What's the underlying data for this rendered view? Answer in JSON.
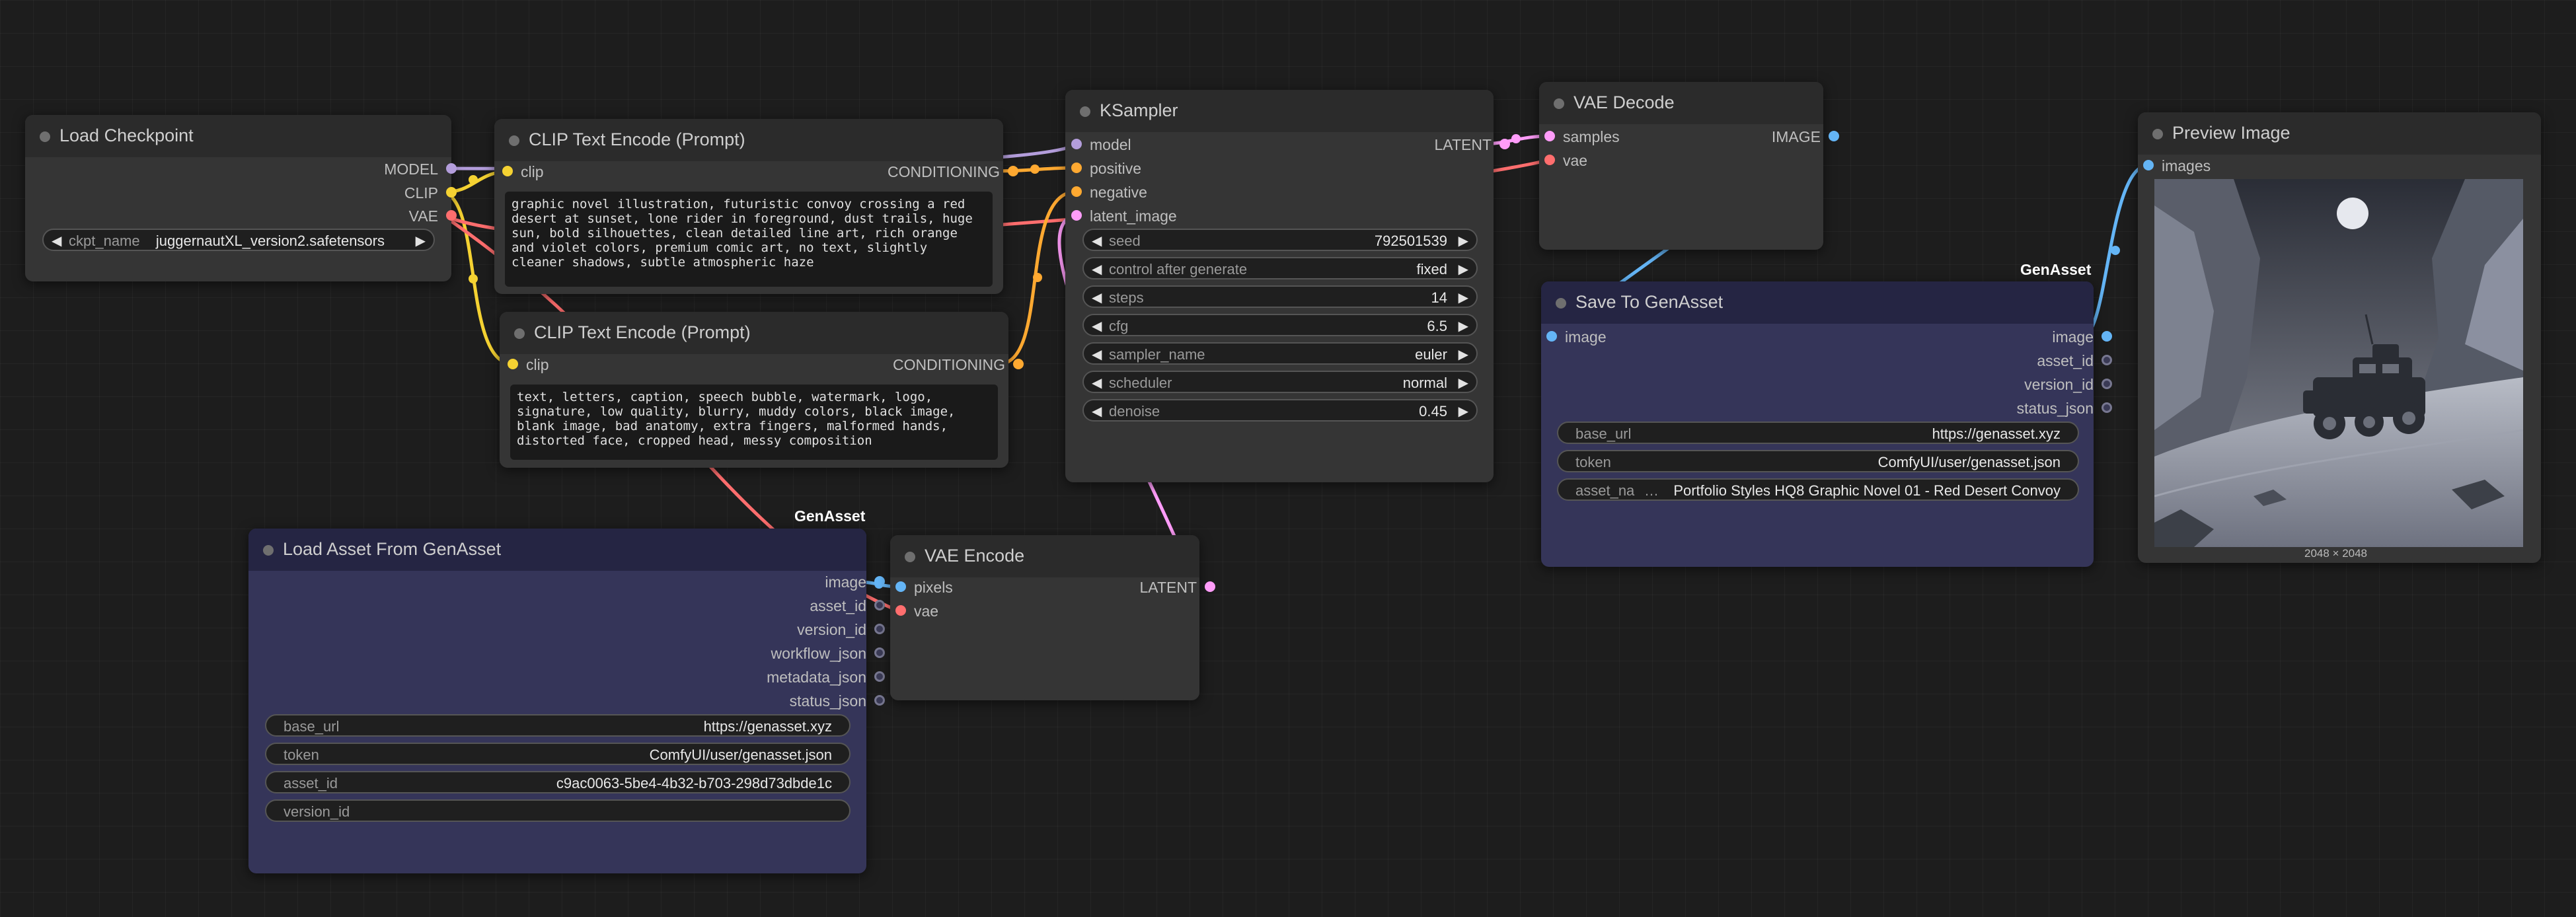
{
  "colors": {
    "model": "#b39ddb",
    "clip": "#f5d232",
    "vae": "#ff6e6e",
    "conditioning": "#ffa931",
    "latent": "#ff9cf9",
    "image": "#64b5f6",
    "generic": "#8a8aa6"
  },
  "nodes": {
    "load_checkpoint": {
      "title": "Load Checkpoint",
      "outputs": [
        "MODEL",
        "CLIP",
        "VAE"
      ],
      "ckpt_label": "ckpt_name",
      "ckpt_value": "juggernautXL_version2.safetensors"
    },
    "clip_pos": {
      "title": "CLIP Text Encode (Prompt)",
      "input": "clip",
      "output": "CONDITIONING",
      "text": "graphic novel illustration, futuristic convoy crossing a red desert at sunset, lone rider in foreground, dust trails, huge sun, bold silhouettes, clean detailed line art, rich orange and violet colors, premium comic art, no text, slightly cleaner shadows, subtle atmospheric haze"
    },
    "clip_neg": {
      "title": "CLIP Text Encode (Prompt)",
      "input": "clip",
      "output": "CONDITIONING",
      "text": "text, letters, caption, speech bubble, watermark, logo, signature, low quality, blurry, muddy colors, black image, blank image, bad anatomy, extra fingers, malformed hands, distorted face, cropped head, messy composition"
    },
    "ksampler": {
      "title": "KSampler",
      "inputs": [
        "model",
        "positive",
        "negative",
        "latent_image"
      ],
      "output": "LATENT",
      "widgets": [
        {
          "label": "seed",
          "value": "792501539"
        },
        {
          "label": "control after generate",
          "value": "fixed"
        },
        {
          "label": "steps",
          "value": "14"
        },
        {
          "label": "cfg",
          "value": "6.5"
        },
        {
          "label": "sampler_name",
          "value": "euler"
        },
        {
          "label": "scheduler",
          "value": "normal"
        },
        {
          "label": "denoise",
          "value": "0.45"
        }
      ]
    },
    "vae_decode": {
      "title": "VAE Decode",
      "inputs": [
        "samples",
        "vae"
      ],
      "output": "IMAGE"
    },
    "save_genasset": {
      "badge": "GenAsset",
      "title": "Save To GenAsset",
      "input": "image",
      "outputs": [
        "image",
        "asset_id",
        "version_id",
        "status_json"
      ],
      "widgets": [
        {
          "label": "base_url",
          "value": "https://genasset.xyz"
        },
        {
          "label": "token",
          "value": "ComfyUI/user/genasset.json"
        },
        {
          "label": "asset_na",
          "value": "Portfolio Styles HQ8 Graphic Novel 01 - Red Desert Convoy"
        }
      ]
    },
    "preview_image": {
      "title": "Preview Image",
      "input": "images",
      "caption": "2048 × 2048"
    },
    "load_genasset": {
      "badge": "GenAsset",
      "title": "Load Asset From GenAsset",
      "outputs": [
        "image",
        "asset_id",
        "version_id",
        "workflow_json",
        "metadata_json",
        "status_json"
      ],
      "widgets": [
        {
          "label": "base_url",
          "value": "https://genasset.xyz"
        },
        {
          "label": "token",
          "value": "ComfyUI/user/genasset.json"
        },
        {
          "label": "asset_id",
          "value": "c9ac0063-5be4-4b32-b703-298d73dbde1c"
        },
        {
          "label": "version_id",
          "value": ""
        }
      ]
    },
    "vae_encode": {
      "title": "VAE Encode",
      "inputs": [
        "pixels",
        "vae"
      ],
      "output": "LATENT"
    }
  }
}
